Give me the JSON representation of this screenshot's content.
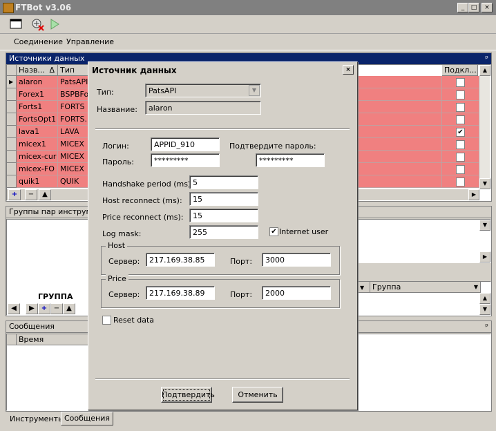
{
  "app": {
    "title": "FTBot v3.06",
    "window_buttons": [
      "_",
      "□",
      "×"
    ]
  },
  "toolbar": {
    "icons": [
      "window-icon",
      "disconnect-icon",
      "play-icon"
    ]
  },
  "menu": [
    "Соединение",
    "Управление"
  ],
  "sources_panel": {
    "title": "Источники данных",
    "columns": [
      "Назв...",
      "Тип",
      "Подкл..."
    ],
    "sort_indicator": "Δ",
    "rows": [
      {
        "name": "alaron",
        "type": "PatsAPI",
        "connected": false,
        "current": true
      },
      {
        "name": "Forex1",
        "type": "BSPBFo...",
        "connected": false
      },
      {
        "name": "Forts1",
        "type": "FORTS",
        "connected": false
      },
      {
        "name": "FortsOpt1",
        "type": "FORTS...",
        "connected": false
      },
      {
        "name": "lava1",
        "type": "LAVA",
        "connected": true
      },
      {
        "name": "micex1",
        "type": "MICEX",
        "connected": false
      },
      {
        "name": "micex-cur",
        "type": "MICEX",
        "connected": false
      },
      {
        "name": "micex-FO",
        "type": "MICEX",
        "connected": false
      },
      {
        "name": "quik1",
        "type": "QUIK",
        "connected": false
      }
    ],
    "nav": [
      "+",
      "−",
      "▲"
    ]
  },
  "groups_panel": {
    "title": "Группы пар инструмен",
    "group_label": "ГРУППА",
    "right_col": "Группа",
    "nav": [
      "◀",
      "▶",
      "+",
      "−",
      "▲"
    ]
  },
  "messages_panel": {
    "title": "Сообщения",
    "col_time": "Время"
  },
  "bottom_tabs": [
    "Инструменты",
    "Сообщения"
  ],
  "dialog": {
    "title": "Источник данных",
    "type_label": "Тип:",
    "type_value": "PatsAPI",
    "name_label": "Название:",
    "name_value": "alaron",
    "login_label": "Логин:",
    "login_value": "APPID_910",
    "password_label": "Пароль:",
    "password_value": "*********",
    "confirm_password_label": "Подтвердите пароль:",
    "confirm_password_value": "*********",
    "handshake_label": "Handshake period (ms):",
    "handshake_value": "5",
    "host_reconnect_label": "Host reconnect (ms):",
    "host_reconnect_value": "15",
    "price_reconnect_label": "Price reconnect (ms):",
    "price_reconnect_value": "15",
    "log_mask_label": "Log mask:",
    "log_mask_value": "255",
    "internet_user_label": "Internet user",
    "internet_user_checked": true,
    "host_group": "Host",
    "price_group": "Price",
    "server_label": "Сервер:",
    "port_label": "Порт:",
    "host_server": "217.169.38.85",
    "host_port": "3000",
    "price_server": "217.169.38.89",
    "price_port": "2000",
    "reset_label": "Reset data",
    "reset_checked": false,
    "ok_label": "Подтвердить",
    "cancel_label": "Отменить"
  }
}
